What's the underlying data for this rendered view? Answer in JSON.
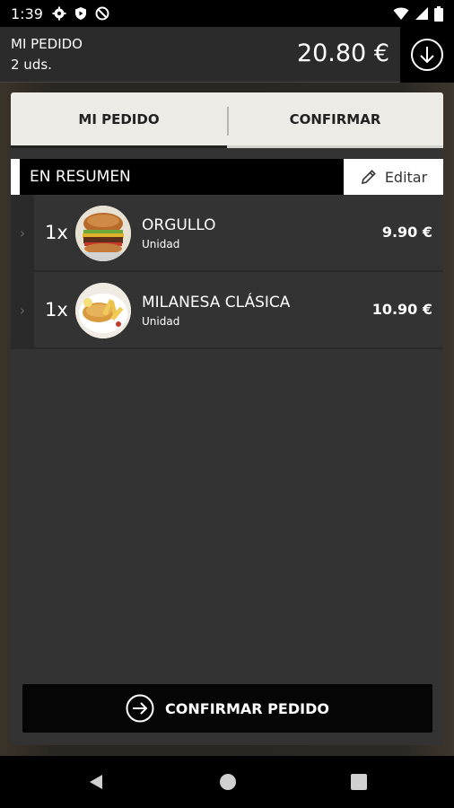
{
  "status_bar": {
    "time": "1:39",
    "left_icons": [
      "gear-icon",
      "play-shield-icon",
      "no-sim-icon"
    ],
    "right_icons": [
      "wifi-icon",
      "signal-icon",
      "battery-icon"
    ]
  },
  "header": {
    "title": "MI PEDIDO",
    "count": "2 uds.",
    "total": "20.80 €",
    "download_icon": "arrow-down-circle-icon"
  },
  "tabs": [
    {
      "label": "MI PEDIDO",
      "active": true
    },
    {
      "label": "CONFIRMAR",
      "active": false
    }
  ],
  "summary": {
    "title": "EN RESUMEN",
    "edit_label": "Editar"
  },
  "items": [
    {
      "qty": "1x",
      "name": "ORGULLO",
      "unit": "Unidad",
      "price": "9.90 €",
      "image": "burger"
    },
    {
      "qty": "1x",
      "name": "MILANESA CLÁSICA",
      "unit": "Unidad",
      "price": "10.90 €",
      "image": "milanesa"
    }
  ],
  "confirm_button": {
    "label": "CONFIRMAR PEDIDO",
    "icon": "arrow-right-circle-icon"
  },
  "nav": [
    "back-icon",
    "home-icon",
    "recents-icon"
  ],
  "colors": {
    "panel": "#333333",
    "header": "#2b2b2b",
    "tab_bg": "#ecebe6",
    "button": "#050505"
  }
}
